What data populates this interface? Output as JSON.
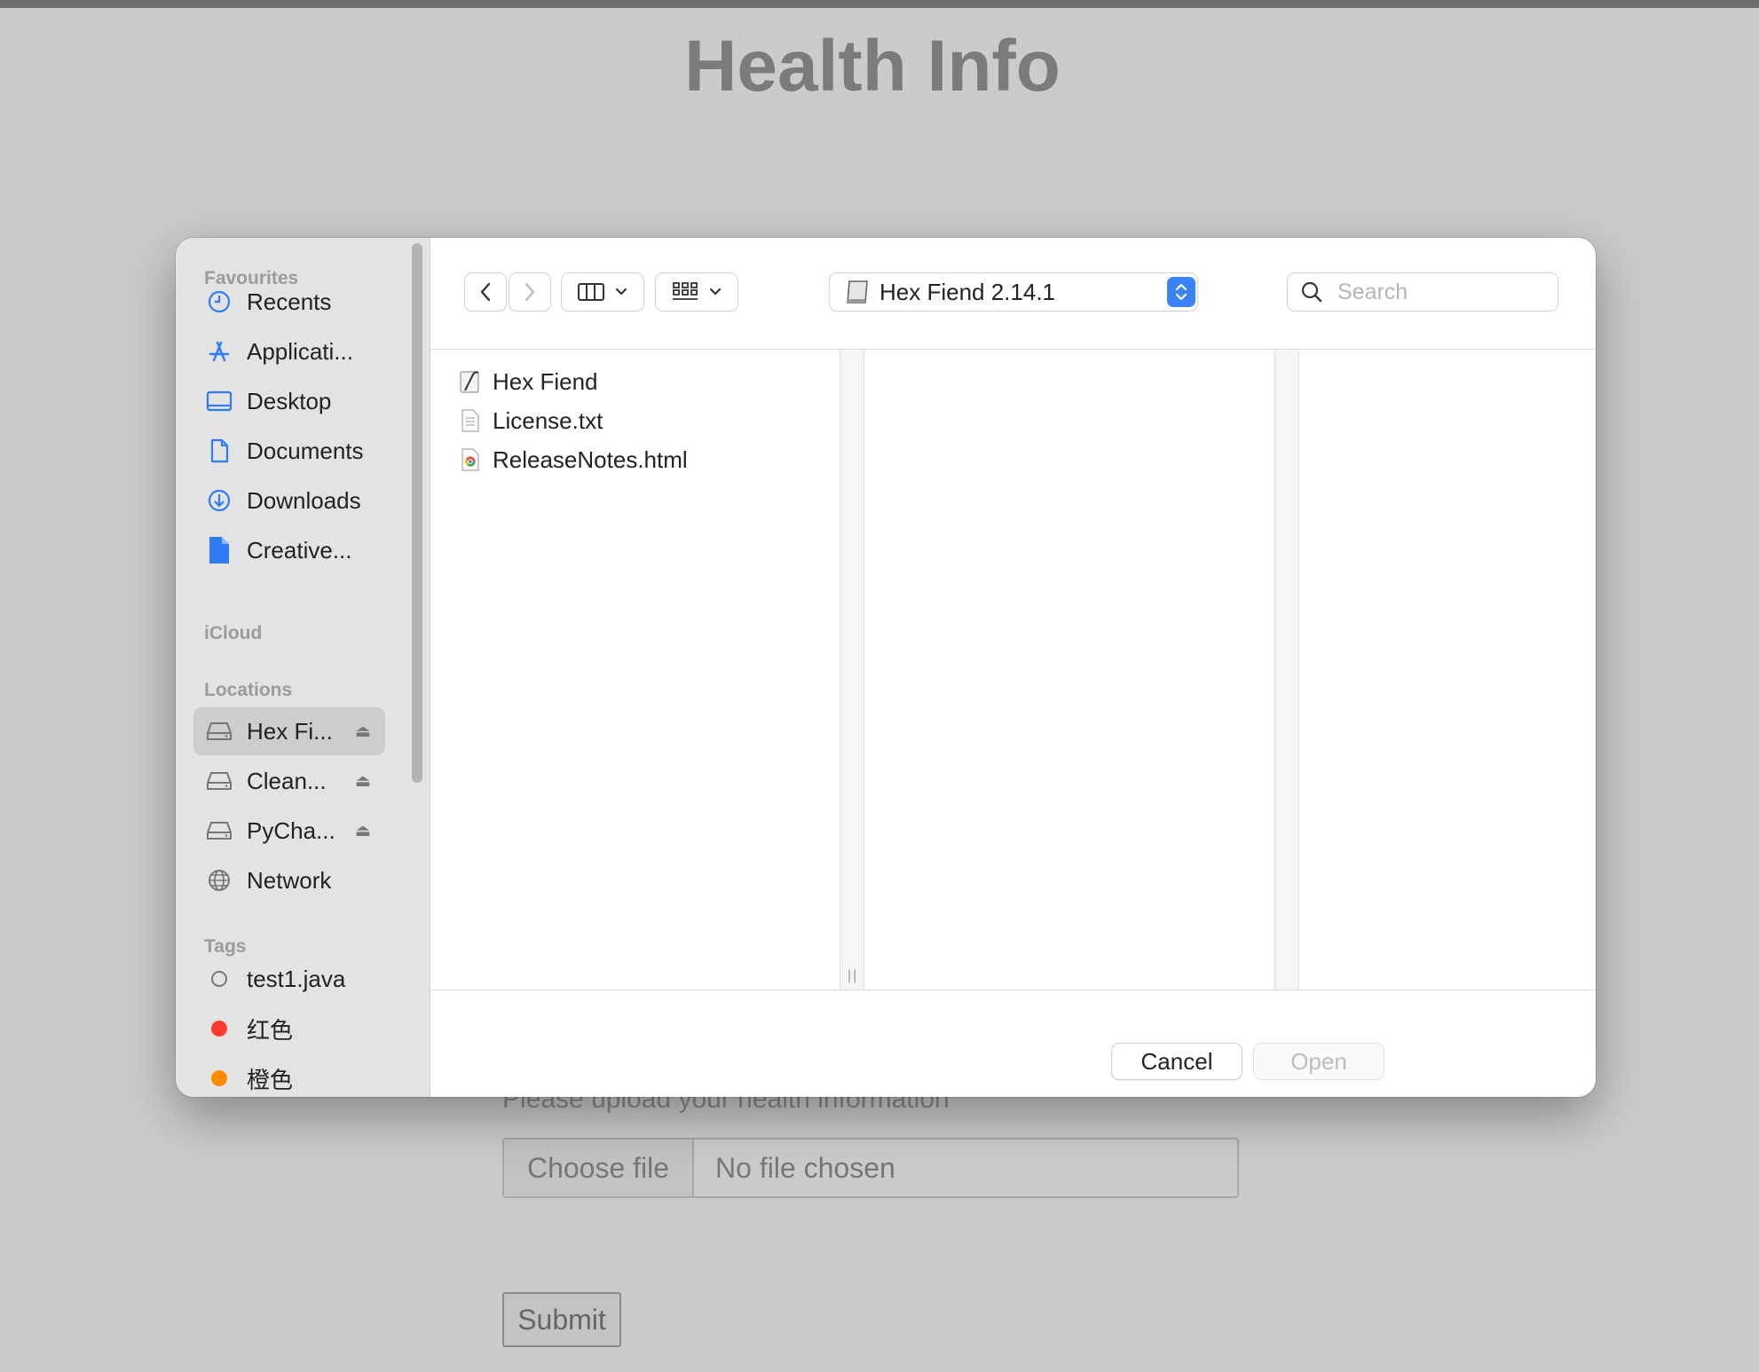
{
  "page": {
    "title": "Health Info",
    "upload_label": "Please upload your health information",
    "choose_file": "Choose file",
    "no_file": "No file chosen",
    "submit": "Submit"
  },
  "sidebar": {
    "favourites_heading": "Favourites",
    "favourites": [
      {
        "label": "Recents",
        "icon": "clock-icon"
      },
      {
        "label": "Applicati...",
        "icon": "applications-icon"
      },
      {
        "label": "Desktop",
        "icon": "desktop-icon"
      },
      {
        "label": "Documents",
        "icon": "document-icon"
      },
      {
        "label": "Downloads",
        "icon": "download-icon"
      },
      {
        "label": "Creative...",
        "icon": "file-icon"
      }
    ],
    "icloud_heading": "iCloud",
    "locations_heading": "Locations",
    "locations": [
      {
        "label": "Hex Fi...",
        "icon": "drive-icon",
        "selected": true
      },
      {
        "label": "Clean...",
        "icon": "drive-icon"
      },
      {
        "label": "PyCha...",
        "icon": "drive-icon"
      },
      {
        "label": "Network",
        "icon": "globe-icon"
      }
    ],
    "tags_heading": "Tags",
    "tags": [
      {
        "label": "test1.java",
        "color": "none"
      },
      {
        "label": "红色",
        "color": "#ff3b30"
      },
      {
        "label": "橙色",
        "color": "#ff8c00"
      }
    ]
  },
  "toolbar": {
    "path": "Hex Fiend 2.14.1",
    "search_placeholder": "Search",
    "accent": "#3b82f6"
  },
  "files": [
    {
      "name": "Hex Fiend",
      "icon": "app-icon"
    },
    {
      "name": "License.txt",
      "icon": "text-file-icon"
    },
    {
      "name": "ReleaseNotes.html",
      "icon": "html-file-icon"
    }
  ],
  "footer": {
    "cancel": "Cancel",
    "open": "Open"
  }
}
